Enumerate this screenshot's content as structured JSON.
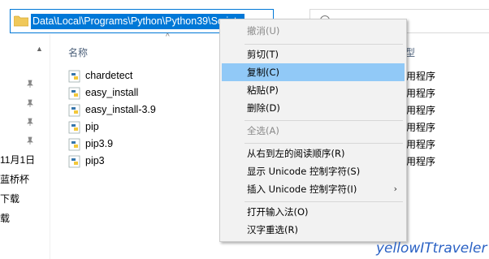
{
  "address": {
    "path_selected": "Data\\Local\\Programs\\Python\\Python39\\Scripts",
    "dropdown_icon": "chevron-down-icon"
  },
  "search": {
    "icon": "search-icon"
  },
  "nav": {
    "items": [
      {
        "label": "11月1日"
      },
      {
        "label": "蓝桥杯"
      },
      {
        "label": "下载"
      },
      {
        "label": "载"
      },
      {
        "label": ""
      }
    ]
  },
  "list": {
    "columns": {
      "name": "名称",
      "type": "型"
    },
    "files": [
      {
        "name": "chardetect",
        "type": "用程序"
      },
      {
        "name": "easy_install",
        "type": "用程序"
      },
      {
        "name": "easy_install-3.9",
        "type": "用程序"
      },
      {
        "name": "pip",
        "type": "用程序"
      },
      {
        "name": "pip3.9",
        "type": "用程序"
      },
      {
        "name": "pip3",
        "type": "用程序"
      }
    ]
  },
  "menu": {
    "undo": "撤消(U)",
    "cut": "剪切(T)",
    "copy": "复制(C)",
    "paste": "粘贴(P)",
    "delete": "删除(D)",
    "select_all": "全选(A)",
    "rtl": "从右到左的阅读顺序(R)",
    "show_unicode": "显示 Unicode 控制字符(S)",
    "insert_unicode": "插入 Unicode 控制字符(I)",
    "open_ime": "打开输入法(O)",
    "reconversion": "汉字重选(R)",
    "submenu_arrow": "›"
  },
  "watermark": "yellowITtraveler",
  "colors": {
    "selection": "#0078d7",
    "menu_highlight": "#91c9f7",
    "menu_bg": "#f2f2f2"
  }
}
